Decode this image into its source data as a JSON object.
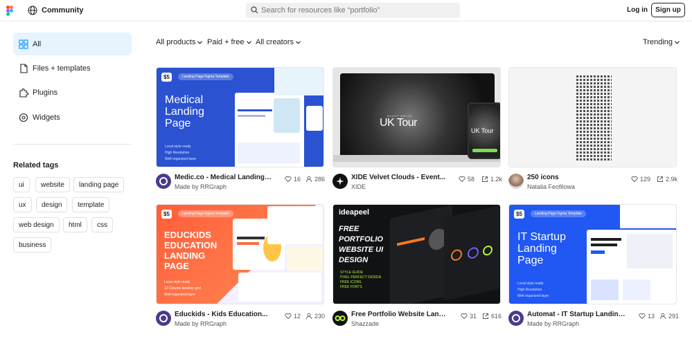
{
  "header": {
    "brand": "Community",
    "search_placeholder": "Search for resources like “portfolio”",
    "login": "Log in",
    "signup": "Sign up"
  },
  "sidebar": {
    "items": [
      {
        "label": "All",
        "icon": "grid-icon"
      },
      {
        "label": "Files + templates",
        "icon": "file-icon"
      },
      {
        "label": "Plugins",
        "icon": "plugin-icon"
      },
      {
        "label": "Widgets",
        "icon": "widget-icon"
      }
    ],
    "tags_title": "Related tags",
    "tags": [
      "ui",
      "website",
      "landing page",
      "ux",
      "design",
      "template",
      "web design",
      "html",
      "css",
      "business"
    ]
  },
  "filters": {
    "products": "All products",
    "pricing": "Paid + free",
    "creators": "All creators",
    "sort": "Trending"
  },
  "cards": [
    {
      "title": "Medic.co - Medical Landing Pa...",
      "author": "Made by RRGraph",
      "likes": "16",
      "uses": "286",
      "stat_icon": "users-icon",
      "thumb": {
        "price": "$5",
        "tag": "Landing Page Figma Template",
        "headline_lines": [
          "Medical",
          "Landing",
          "Page"
        ],
        "bullets": [
          "Local style ready",
          "High Resolution",
          "Well organized layer"
        ]
      }
    },
    {
      "title": "XIDE Velvet Clouds - Event...",
      "author": "XIDE",
      "likes": "58",
      "uses": "1.2k",
      "stat_icon": "duplicate-icon",
      "thumb": {
        "headline": "UK Tour",
        "sub": "NIGHT DRIVE"
      }
    },
    {
      "title": "250 icons",
      "author": "Natalia Feofilowa",
      "likes": "129",
      "uses": "2.9k",
      "stat_icon": "duplicate-icon"
    },
    {
      "title": "Educkids - Kids Education...",
      "author": "Made by RRGraph",
      "likes": "12",
      "uses": "230",
      "stat_icon": "users-icon",
      "thumb": {
        "price": "$5",
        "tag": "Landing Page Figma Template",
        "headline_lines": [
          "EDUCKIDS",
          "EDUCATION",
          "LANDING",
          "PAGE"
        ],
        "bullets": [
          "Local style ready",
          "12 Column desktop grid",
          "Well organized layer"
        ]
      }
    },
    {
      "title": "Free Portfolio Website Landing...",
      "author": "Shazzade",
      "likes": "31",
      "uses": "616",
      "stat_icon": "duplicate-icon",
      "thumb": {
        "brand": "ideapeel",
        "headline_lines": [
          "FREE",
          "PORTFOLIO",
          "WEBSITE UI",
          "DESIGN"
        ],
        "bullets": [
          "STYLE GUIDE",
          "PIXEL PERFECT DESIGN",
          "FREE ICONS",
          "FREE FONTS"
        ]
      }
    },
    {
      "title": "Automat - IT Startup Landing...",
      "author": "Made by RRGraph",
      "likes": "13",
      "uses": "291",
      "stat_icon": "users-icon",
      "thumb": {
        "price": "$5",
        "tag": "Landing Page Figma Template",
        "headline_lines": [
          "IT Startup",
          "Landing",
          "Page"
        ],
        "bullets": [
          "Local style ready",
          "High Resolution",
          "Well organized layer"
        ]
      }
    }
  ],
  "colors": {
    "accent_bg": "#e5f4ff",
    "medical_blue": "#2a52d1",
    "educ_orange": "#ff6a3d",
    "ideapeel_green": "#b8f52b",
    "it_blue": "#2157f2"
  }
}
